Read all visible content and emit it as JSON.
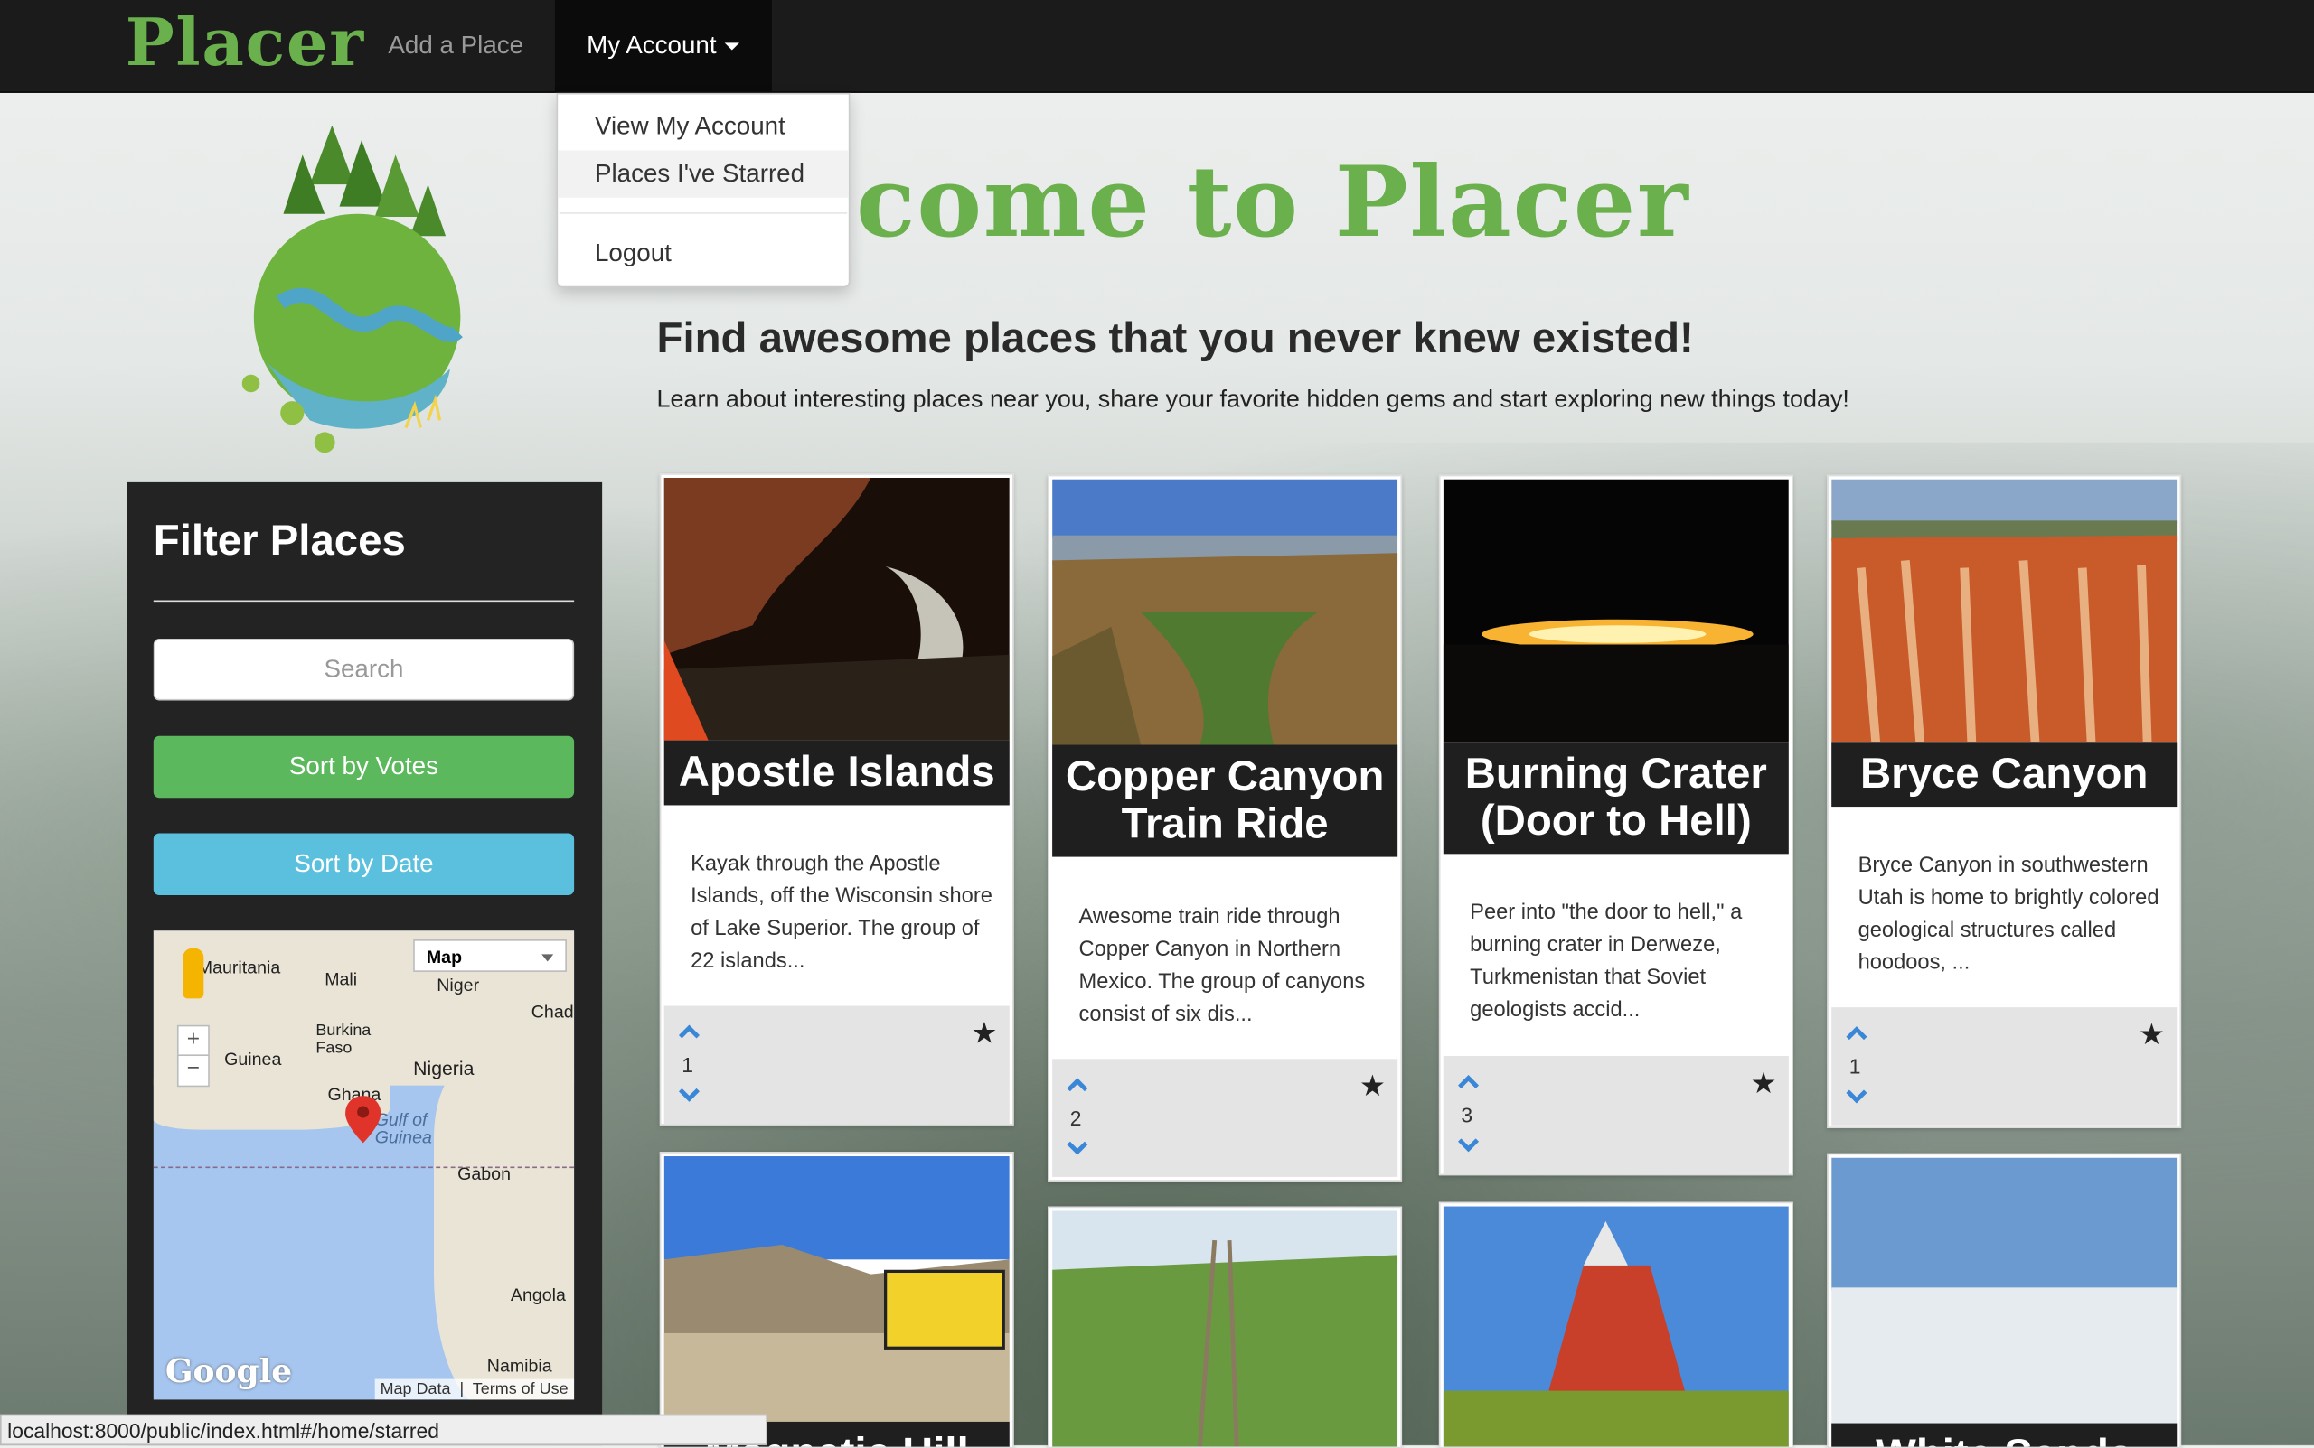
{
  "nav": {
    "brand": "Placer",
    "add_place": "Add a Place",
    "my_account": "My Account"
  },
  "dropdown": {
    "items": [
      "View My Account",
      "Places I've Starred",
      "Logout"
    ]
  },
  "hero": {
    "welcome": "come to Placer",
    "headline": "Find awesome places that you never knew existed!",
    "subline": "Learn about interesting places near you, share your favorite hidden gems and start exploring new things today!"
  },
  "filter": {
    "title": "Filter Places",
    "search_placeholder": "Search",
    "sort_votes": "Sort by Votes",
    "sort_date": "Sort by Date"
  },
  "map": {
    "type": "Map",
    "labels": [
      "Mauritania",
      "Mali",
      "Niger",
      "Chad",
      "Burkina Faso",
      "Guinea",
      "Nigeria",
      "Ghana",
      "Gulf of Guinea",
      "Gabon",
      "Angola",
      "Namibia"
    ],
    "google": "Google",
    "map_data": "Map Data",
    "terms": "Terms of Use"
  },
  "cards": [
    {
      "title": "Apostle Islands",
      "desc": "Kayak through the Apostle Islands, off the Wisconsin shore of Lake Superior. The group of 22 islands...",
      "votes": "1"
    },
    {
      "title": "Copper Canyon Train Ride",
      "desc": "Awesome train ride through Copper Canyon in Northern Mexico. The group of canyons consist of six dis...",
      "votes": "2"
    },
    {
      "title": "Burning Crater (Door to Hell)",
      "desc": "Peer into \"the door to hell,\" a burning crater in Derweze, Turkmenistan that Soviet geologists accid...",
      "votes": "3"
    },
    {
      "title": "Bryce Canyon",
      "desc": "Bryce Canyon in southwestern Utah is home to brightly colored geological structures called hoodoos, ...",
      "votes": "1"
    }
  ],
  "cards_row2": [
    "Magnetic Hill",
    "White Sands"
  ],
  "status_url": "localhost:8000/public/index.html#/home/starred",
  "colors": {
    "brand_green": "#6ab04c",
    "votes_btn": "#5cb85c",
    "date_btn": "#5bc0de",
    "navbar": "#1b1b1b",
    "arrow_blue": "#3a87d8"
  }
}
